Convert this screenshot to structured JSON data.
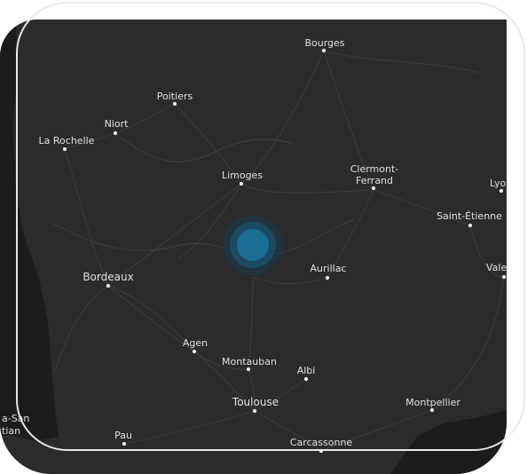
{
  "map": {
    "colors": {
      "land": "#2b2b2b",
      "ocean": "#1c1c1c",
      "road": "#3f3f3f",
      "marker": "#1a6e93",
      "marker_halo": "#1a4e66",
      "label": "#e0e0e0",
      "outline": "#e8e8e8"
    },
    "marker_icon": "location-dot-icon",
    "cities": {
      "bourges": "Bourges",
      "poitiers": "Poitiers",
      "niort": "Niort",
      "la_rochelle": "La Rochelle",
      "limoges": "Limoges",
      "clermont_1": "Clermont-",
      "clermont_2": "Ferrand",
      "lyon": "Lyo",
      "saint_etienne": "Saint-Étienne",
      "bordeaux": "Bordeaux",
      "aurillac": "Aurillac",
      "valence": "Vale",
      "agen": "Agen",
      "montauban": "Montauban",
      "albi": "Albi",
      "toulouse": "Toulouse",
      "montpellier": "Montpellier",
      "pau": "Pau",
      "carcassonne": "Carcassonne",
      "saint_sebastian_1": "a-San",
      "saint_sebastian_2": "tian"
    }
  }
}
